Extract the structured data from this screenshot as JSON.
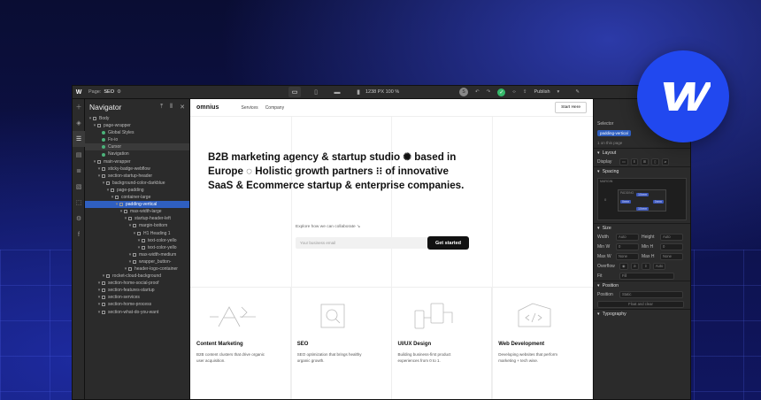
{
  "topbar": {
    "page_label": "Page:",
    "page_name": "SEO",
    "canvas_size": "1238 PX  100 %",
    "avatar_initial": "S",
    "publish_label": "Publish"
  },
  "navigator": {
    "title": "Navigator",
    "items": [
      {
        "label": "Body",
        "indent": 0,
        "kind": "box"
      },
      {
        "label": "page-wrapper",
        "indent": 1,
        "kind": "box"
      },
      {
        "label": "Global Styles",
        "indent": 2,
        "kind": "sym"
      },
      {
        "label": "Fx-io",
        "indent": 2,
        "kind": "sym"
      },
      {
        "label": "Cursor",
        "indent": 2,
        "kind": "sym"
      },
      {
        "label": "Navigation",
        "indent": 2,
        "kind": "sym"
      },
      {
        "label": "main-wrapper",
        "indent": 1,
        "kind": "box"
      },
      {
        "label": "sticky-badge-webflow",
        "indent": 2,
        "kind": "box"
      },
      {
        "label": "section-startup-header",
        "indent": 2,
        "kind": "box"
      },
      {
        "label": "background-color-darkblue",
        "indent": 3,
        "kind": "box"
      },
      {
        "label": "page-padding",
        "indent": 4,
        "kind": "box"
      },
      {
        "label": "container-large",
        "indent": 5,
        "kind": "box"
      },
      {
        "label": "padding-vertical",
        "indent": 6,
        "kind": "box"
      },
      {
        "label": "max-width-large",
        "indent": 7,
        "kind": "box"
      },
      {
        "label": "startup-header-left",
        "indent": 8,
        "kind": "box"
      },
      {
        "label": "margin-bottom",
        "indent": 9,
        "kind": "box"
      },
      {
        "label": "H1 Heading 1",
        "indent": 10,
        "kind": "box"
      },
      {
        "label": "text-color-yello",
        "indent": 11,
        "kind": "box"
      },
      {
        "label": "text-color-yello",
        "indent": 11,
        "kind": "box"
      },
      {
        "label": "max-width-medium",
        "indent": 9,
        "kind": "box"
      },
      {
        "label": "wrapper_button-",
        "indent": 9,
        "kind": "box"
      },
      {
        "label": "header-logo-container",
        "indent": 8,
        "kind": "box"
      },
      {
        "label": "rocket-cloud-background",
        "indent": 3,
        "kind": "box"
      },
      {
        "label": "section-home-social-proof",
        "indent": 2,
        "kind": "box"
      },
      {
        "label": "section-features-startup",
        "indent": 2,
        "kind": "box"
      },
      {
        "label": "section-services",
        "indent": 2,
        "kind": "box"
      },
      {
        "label": "section-home-process",
        "indent": 2,
        "kind": "box"
      },
      {
        "label": "section-what-do-you-want",
        "indent": 2,
        "kind": "box"
      }
    ]
  },
  "site": {
    "brand": "omnius",
    "nav_links": [
      "Services",
      "Company"
    ],
    "start_here": "Start Here",
    "hero_line1": "B2B marketing agency & startup studio ✺ based in",
    "hero_line2": "Europe ◌ Holistic growth partners ⁝⁝ of innovative",
    "hero_line3": "SaaS & Ecommerce startup & enterprise companies.",
    "explore_text": "Explore how we can collaborate ↘",
    "email_placeholder": "Your business email",
    "get_started": "Get started",
    "cards": [
      {
        "title": "Content Marketing",
        "desc": "B2B content clusters that drive organic user acquisition."
      },
      {
        "title": "SEO",
        "desc": "SEO optimization that brings healthy organic growth."
      },
      {
        "title": "UI/UX Design",
        "desc": "Building business-first product experiences from 0 to 1."
      },
      {
        "title": "Web Development",
        "desc": "Developing websites that perform marketing + tech wise."
      }
    ]
  },
  "panel": {
    "selector_label": "Selector",
    "selector_pill": "padding-vertical",
    "on_this_page": "1 on this page",
    "layout": "Layout",
    "display_label": "Display",
    "spacing": "Spacing",
    "margin_label": "MARGIN",
    "padding_label": "PADDING",
    "padding_top": "10rem",
    "padding_bottom": "10rem",
    "padding_left": "0rem",
    "padding_right": "0rem",
    "zero": "0",
    "size": "Size",
    "width_label": "Width",
    "height_label": "Height",
    "auto": "Auto",
    "min_w": "Min W",
    "min_h": "Min H",
    "max_w": "Max W",
    "max_h": "Max H",
    "none": "None",
    "zero_px": "0",
    "px_unit": "PX",
    "overflow": "Overflow",
    "fit": "Fit",
    "fill": "Fill",
    "position": "Position",
    "position_label": "Position",
    "static": "Static",
    "float_clear": "Float and clear",
    "typography": "Typography"
  },
  "colors": {
    "accent": "#2f5fc0",
    "webflow_blue": "#2148ef",
    "ok_green": "#35b86a"
  }
}
